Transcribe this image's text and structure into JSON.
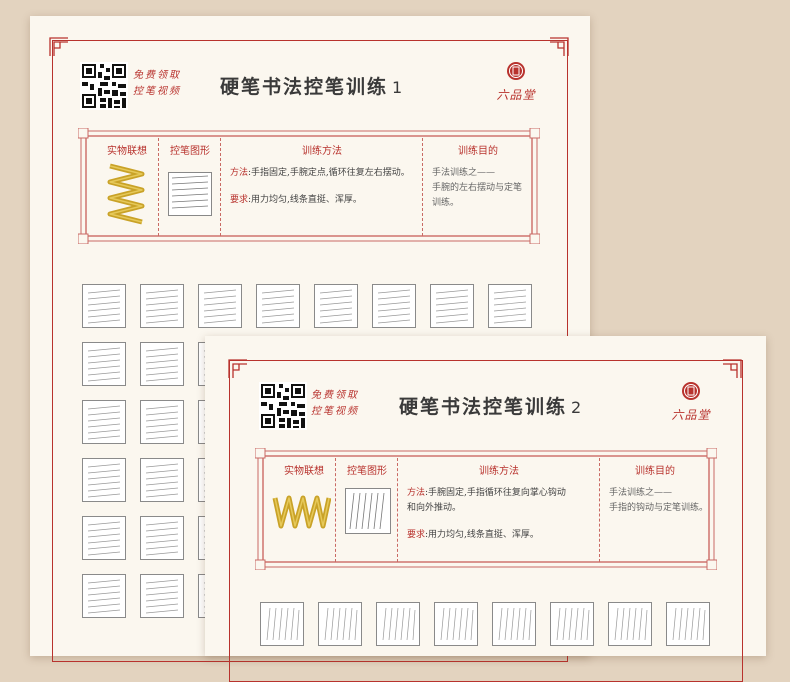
{
  "sheets": [
    {
      "qr_text_line1": "免费领取",
      "qr_text_line2": "控笔视频",
      "title": "硬笔书法控笔训练",
      "title_number": "1",
      "brand": "六品堂",
      "headers": {
        "object": "实物联想",
        "shape": "控笔图形",
        "method": "训练方法",
        "purpose": "训练目的"
      },
      "method_label": "方法",
      "method_text": ":手指固定,手腕定点,循环往复左右摆动。",
      "require_label": "要求",
      "require_text": ":用力均匀,线条直挺、浑厚。",
      "purpose_line1": "手法训练之——",
      "purpose_line2": "手腕的左右摆动与定笔",
      "purpose_line3": "训练。"
    },
    {
      "qr_text_line1": "免费领取",
      "qr_text_line2": "控笔视频",
      "title": "硬笔书法控笔训练",
      "title_number": "2",
      "brand": "六品堂",
      "headers": {
        "object": "实物联想",
        "shape": "控笔图形",
        "method": "训练方法",
        "purpose": "训练目的"
      },
      "method_label": "方法",
      "method_text": ":手腕固定,手指循环往复向掌心钩动",
      "method_text2": "和向外推动。",
      "require_label": "要求",
      "require_text": ":用力均匀,线条直挺、浑厚。",
      "purpose_line1": "手法训练之——",
      "purpose_line2": "手指的钩动与定笔训练。"
    }
  ],
  "colors": {
    "accent": "#b8322d",
    "gold": "#c9a227",
    "paper": "#fbf7ef",
    "background": "#e3d3bf"
  },
  "icons": [
    "qr-code-icon",
    "corner-ornament-icon",
    "brand-seal-icon",
    "zigzag-spring-icon"
  ]
}
